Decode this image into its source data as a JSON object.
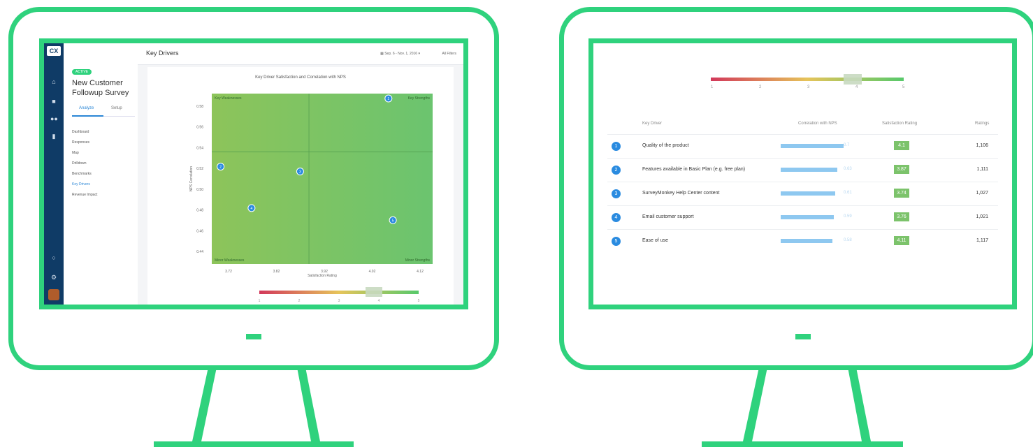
{
  "colors": {
    "frame": "#2fd27d",
    "nav": "#0f3b66",
    "accent": "#2a86d6"
  },
  "left_screen": {
    "nav_icons": [
      "logo-icon",
      "home-icon",
      "survey-icon",
      "contacts-icon",
      "document-icon",
      "clock-icon",
      "settings-icon"
    ],
    "status_badge": "ACTIVE",
    "survey_title": "New Customer Followup Survey",
    "tabs": [
      "Analyze",
      "Setup"
    ],
    "menu": [
      "Dashboard",
      "Responses",
      "Map",
      "Drilldown",
      "Benchmarks",
      "Key Drivers",
      "Revenue Impact"
    ],
    "active_menu": "Key Drivers",
    "page_title": "Key Drivers",
    "date_range": "Sep. 6 - Nov. 1, 2016",
    "filters_label": "All Filters",
    "chart_title": "Key Driver Satisfaction and Correlation with NPS",
    "quadrant_labels": [
      "Key Weaknesses",
      "Key Strengths",
      "Minor Weaknesses",
      "Minor Strengths"
    ],
    "scale_ticks": [
      "1",
      "2",
      "3",
      "4",
      "5"
    ]
  },
  "chart_data": {
    "type": "scatter",
    "title": "Key Driver Satisfaction and Correlation with NPS",
    "xlabel": "Satisfaction Rating",
    "ylabel": "NPS Correlation",
    "xlim": [
      3.7,
      4.2
    ],
    "ylim": [
      0.52,
      0.59
    ],
    "x_ticks": [
      "3.72",
      "3.82",
      "3.92",
      "4.02",
      "4.12"
    ],
    "y_ticks": [
      "0.58",
      "0.56",
      "0.54",
      "0.52",
      "0.50",
      "0.48",
      "0.46",
      "0.44"
    ],
    "points": [
      {
        "label": "1",
        "x": 4.1,
        "y": 0.588
      },
      {
        "label": "2",
        "x": 3.72,
        "y": 0.56
      },
      {
        "label": "3",
        "x": 3.9,
        "y": 0.558
      },
      {
        "label": "4",
        "x": 3.79,
        "y": 0.543
      },
      {
        "label": "5",
        "x": 4.11,
        "y": 0.538
      }
    ],
    "quadrant_divider": {
      "x": 3.92,
      "y": 0.566
    }
  },
  "right_screen": {
    "scale_ticks": [
      "1",
      "2",
      "3",
      "4",
      "5"
    ],
    "headers": {
      "driver": "Key Driver",
      "correlation": "Correlation with NPS",
      "satisfaction": "Satisfaction Rating",
      "ratings": "Ratings"
    },
    "rows": [
      {
        "num": "1",
        "name": "Quality of the product",
        "correlation": "0.7",
        "corr_value": 0.7,
        "satisfaction": "4.1",
        "ratings": "1,106"
      },
      {
        "num": "2",
        "name": "Features available in Basic Plan (e.g. free plan)",
        "correlation": "0.63",
        "corr_value": 0.63,
        "satisfaction": "3.87",
        "ratings": "1,111"
      },
      {
        "num": "3",
        "name": "SurveyMonkey Help Center content",
        "correlation": "0.61",
        "corr_value": 0.61,
        "satisfaction": "3.74",
        "ratings": "1,027"
      },
      {
        "num": "4",
        "name": "Email customer support",
        "correlation": "0.59",
        "corr_value": 0.59,
        "satisfaction": "3.76",
        "ratings": "1,021"
      },
      {
        "num": "5",
        "name": "Ease of use",
        "correlation": "0.58",
        "corr_value": 0.58,
        "satisfaction": "4.11",
        "ratings": "1,117"
      }
    ]
  }
}
